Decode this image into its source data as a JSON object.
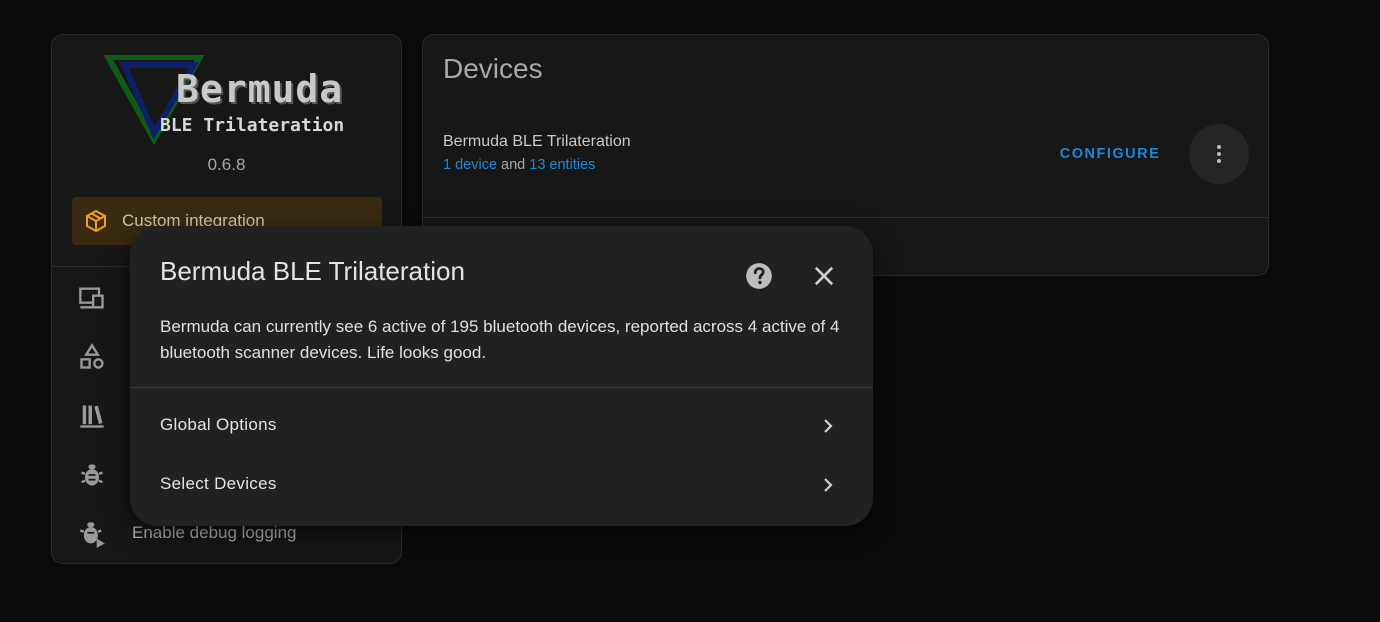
{
  "integration_card": {
    "logo": {
      "title": "Bermuda",
      "subtitle": "BLE Trilateration"
    },
    "version": "0.6.8",
    "custom_badge_label": "Custom integration",
    "menu_icons": [
      "devices-icon",
      "shapes-icon",
      "library-icon",
      "bug-icon",
      "bug-play-icon"
    ],
    "debug_label": "Enable debug logging"
  },
  "devices_card": {
    "title": "Devices",
    "entry": {
      "name": "Bermuda BLE Trilateration",
      "devices_link": "1 device",
      "and_text": " and ",
      "entities_link": "13 entities"
    },
    "configure_label": "CONFIGURE"
  },
  "dialog": {
    "title": "Bermuda BLE Trilateration",
    "message": "Bermuda can currently see 6 active of 195 bluetooth devices, reported across 4 active of 4 bluetooth scanner devices. Life looks good.",
    "items": [
      {
        "label": "Global Options"
      },
      {
        "label": "Select Devices"
      }
    ]
  },
  "colors": {
    "accent": "#1e88d8",
    "custom_badge_bg": "#3a2a12",
    "custom_badge_icon": "#f0a020"
  }
}
